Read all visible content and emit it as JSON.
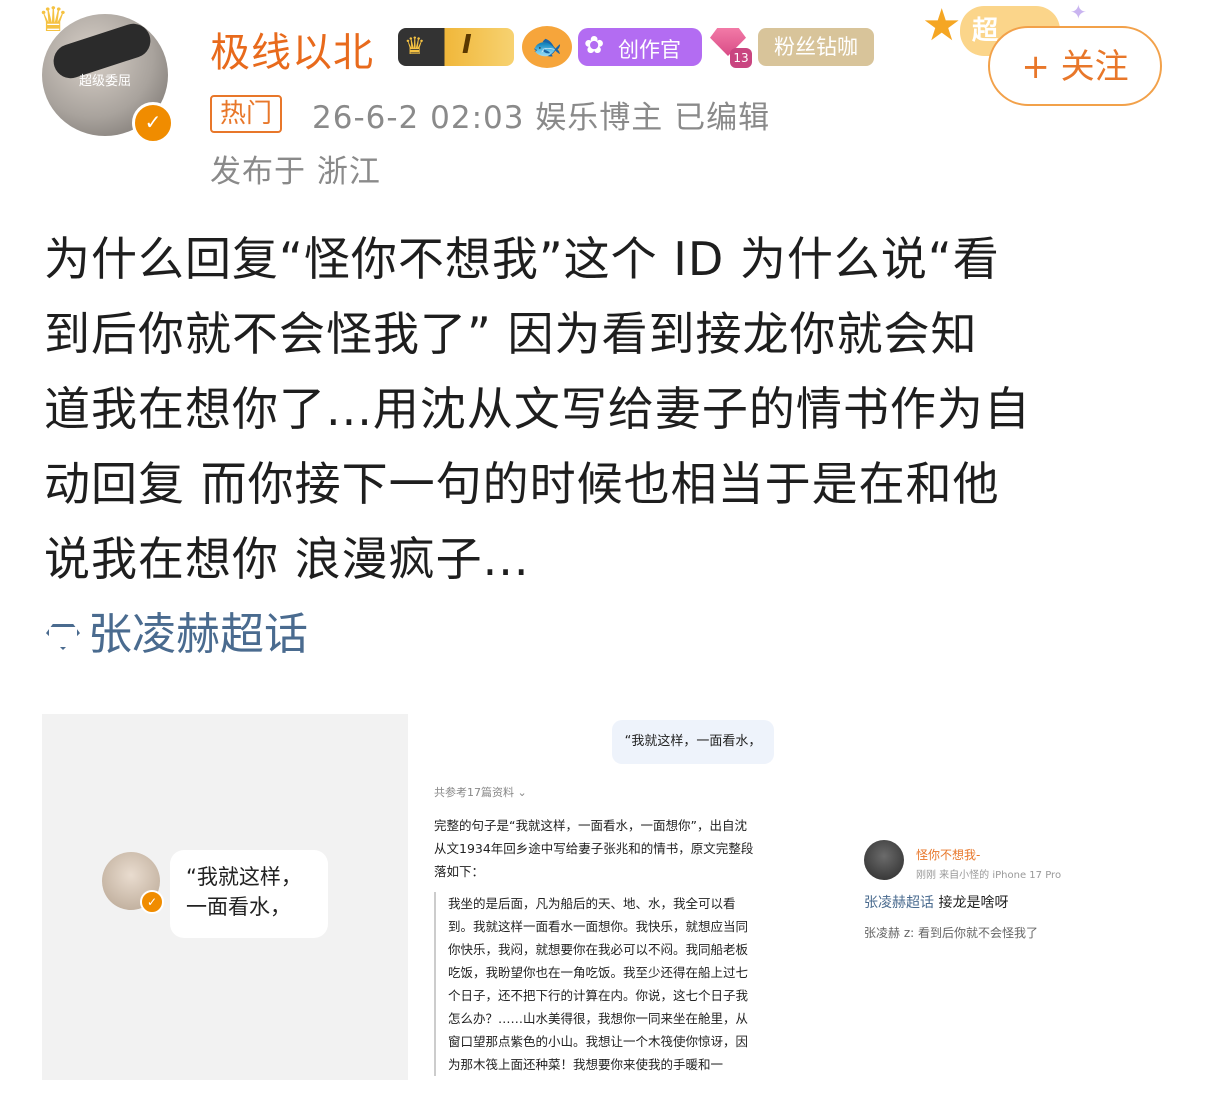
{
  "user": {
    "avatar_text": "超级委屈",
    "name": "极线以北",
    "level": "I",
    "badge_create": "创作官",
    "gem_count": "13",
    "badge_fan": "粉丝钻咖",
    "super_label": "超",
    "follow_button": "+ 关注"
  },
  "meta": {
    "hot_tag": "热门",
    "info": "26-6-2 02:03  娱乐博主  已编辑",
    "location": "发布于 浙江"
  },
  "post": {
    "lines": [
      "为什么回复“怪你不想我”这个 ID  为什么说“看",
      "到后你就不会怪我了”  因为看到接龙你就会知",
      "道我在想你了...用沈从文写给妻子的情书作为自",
      "动回复 而你接下一句的时候也相当于是在和他",
      "说我在想你 浪漫疯子..."
    ],
    "topic": "张凌赫超话"
  },
  "image1": {
    "bubble_line1": "“我就这样，",
    "bubble_line2": "一面看水，"
  },
  "image2": {
    "question": "“我就这样，一面看水，",
    "reference": "共参考17篇资料 ⌄",
    "intro": [
      "完整的句子是“我就这样，一面看水，一面想你”，出自沈",
      "从文1934年回乡途中写给妻子张兆和的情书，原文完整段",
      "落如下："
    ],
    "quote": [
      "我坐的是后面，凡为船后的天、地、水，我全可以看",
      "到。我就这样一面看水一面想你。我快乐，就想应当同",
      "你快乐，我闷，就想要你在我必可以不闷。我同船老板",
      "吃饭，我盼望你也在一角吃饭。我至少还得在船上过七",
      "个日子，还不把下行的计算在内。你说，这七个日子我",
      "怎么办？……山水美得很，我想你一同来坐在舱里，从",
      "窗口望那点紫色的小山。我想让一个木筏使你惊讶，因",
      "为那木筏上面还种菜！我想要你来使我的手暖和一"
    ]
  },
  "image3": {
    "name": "怪你不想我-",
    "meta": "刚刚  来自小怪的 iPhone 17 Pro",
    "topic": "张凌赫超话",
    "line1_rest": " 接龙是啥呀",
    "line2": "张凌赫 z: 看到后你就不会怪我了"
  }
}
